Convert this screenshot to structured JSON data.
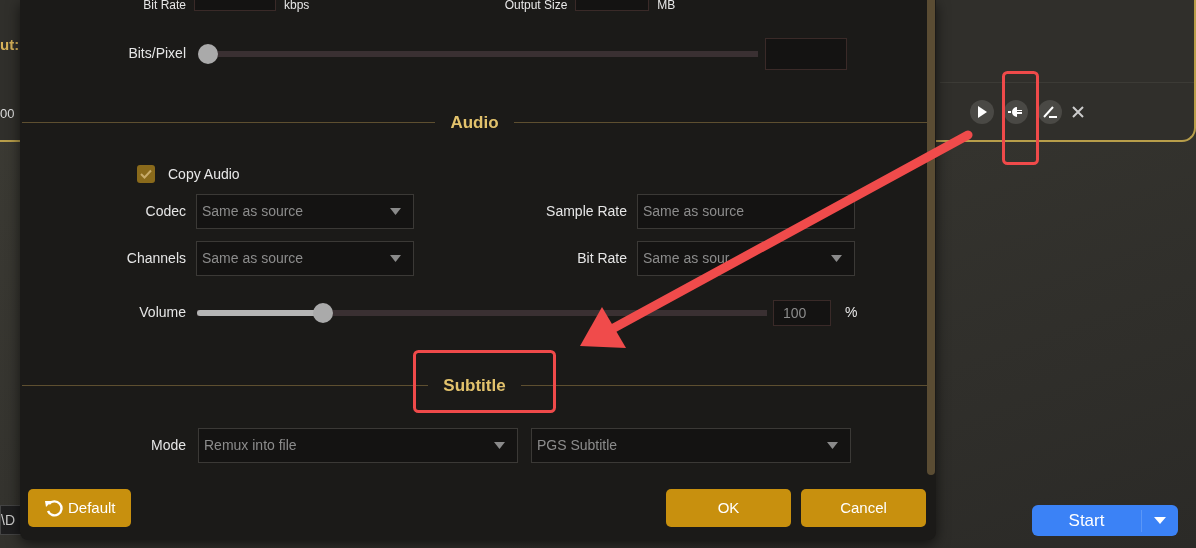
{
  "background": {
    "output_label": "ut:",
    "time": "00",
    "path": "\\D",
    "start_button": "Start"
  },
  "video": {
    "bit_rate_label": "Bit Rate",
    "bit_rate_unit": "kbps",
    "output_size_label": "Output Size",
    "output_size_unit": "MB",
    "bits_pixel_label": "Bits/Pixel",
    "bits_pixel": {
      "level": 0
    }
  },
  "audio": {
    "heading": "Audio",
    "copy_audio": {
      "label": "Copy Audio",
      "checked": true
    },
    "fields": [
      {
        "label": "Codec",
        "value": "Same as source",
        "kind": "select"
      },
      {
        "label": "Sample Rate",
        "value": "Same as source",
        "kind": "input"
      },
      {
        "label": "Channels",
        "value": "Same as source",
        "kind": "select"
      },
      {
        "label": "Bit Rate",
        "value": "Same as sour",
        "kind": "select"
      }
    ],
    "volume": {
      "label": "Volume",
      "level": 0.21,
      "value": "100",
      "unit": "%"
    }
  },
  "subtitle": {
    "heading": "Subtitle",
    "mode_label": "Mode",
    "selects": [
      "Remux into file",
      "PGS Subtitle"
    ]
  },
  "footer": {
    "default_button": "Default",
    "buttons": [
      "OK",
      "Cancel"
    ]
  }
}
